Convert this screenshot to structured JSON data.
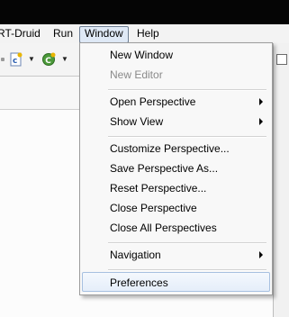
{
  "menubar": {
    "items": [
      {
        "label": "RT-Druid"
      },
      {
        "label": "Run"
      },
      {
        "label": "Window"
      },
      {
        "label": "Help"
      }
    ]
  },
  "toolbar": {
    "icons": [
      "class-file-icon",
      "run-config-icon"
    ]
  },
  "window_menu": {
    "items": [
      {
        "label": "New Window"
      },
      {
        "label": "New Editor"
      },
      {
        "label": "Open Perspective"
      },
      {
        "label": "Show View"
      },
      {
        "label": "Customize Perspective..."
      },
      {
        "label": "Save Perspective As..."
      },
      {
        "label": "Reset Perspective..."
      },
      {
        "label": "Close Perspective"
      },
      {
        "label": "Close All Perspectives"
      },
      {
        "label": "Navigation"
      },
      {
        "label": "Preferences"
      }
    ]
  },
  "colors": {
    "highlight_border": "#a7c0e0",
    "menu_background": "#f8f8f8",
    "titlebar": "#050505"
  }
}
